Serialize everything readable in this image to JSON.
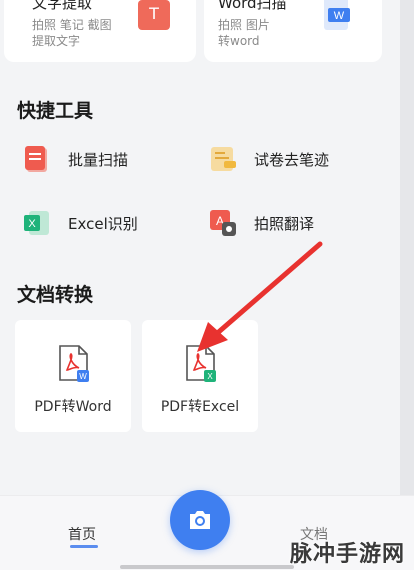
{
  "top_cards": [
    {
      "title": "文字提取",
      "sub1": "拍照 笔记 截图",
      "sub2": "提取文字",
      "badge": "T"
    },
    {
      "title": "Word扫描",
      "sub1": "拍照  图片",
      "sub2": "转word",
      "badge": "W"
    }
  ],
  "quick_tools": {
    "title": "快捷工具",
    "items": [
      {
        "label": "批量扫描",
        "icon": "batch-scan-icon"
      },
      {
        "label": "试卷去笔迹",
        "icon": "exam-clean-icon"
      },
      {
        "label": "Excel识别",
        "icon": "excel-icon"
      },
      {
        "label": "拍照翻译",
        "icon": "translate-icon"
      }
    ]
  },
  "doc_convert": {
    "title": "文档转换",
    "items": [
      {
        "label": "PDF转Word",
        "icon": "pdf-to-word-icon"
      },
      {
        "label": "PDF转Excel",
        "icon": "pdf-to-excel-icon"
      }
    ]
  },
  "bottom_nav": {
    "home": "首页",
    "docs": "文档",
    "camera_icon": "camera-icon"
  },
  "watermark": "脉冲手游网",
  "colors": {
    "accent": "#3f7ff0",
    "arrow": "#e8322f",
    "red_icon": "#ef6a5a",
    "green_icon": "#1fb37a"
  }
}
